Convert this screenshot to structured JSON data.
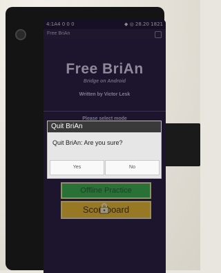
{
  "status_bar": {
    "left": "4:1A4 0 0 0",
    "right": "◆ ◎ 28.20 1821"
  },
  "app_bar": {
    "title": "Free BriAn"
  },
  "main": {
    "title": "Free BriAn",
    "subtitle": "Bridge on Android",
    "author": "Written by Victor Lesk",
    "select_prompt": "Please select mode",
    "mode_buttons": [
      {
        "label": "Offline Practice",
        "icon": "none"
      },
      {
        "label": "Scoreboard",
        "icon": "lock-icon"
      }
    ]
  },
  "dialog": {
    "title": "Quit BriAn",
    "message": "Quit BriAn: Are you sure?",
    "yes_label": "Yes",
    "no_label": "No"
  },
  "colors": {
    "screen_bg": "#2b2146",
    "dialog_title_bg": "#3a3a3a",
    "mode1_bg": "#3fae55",
    "mode2_bg": "#e9b93a"
  }
}
